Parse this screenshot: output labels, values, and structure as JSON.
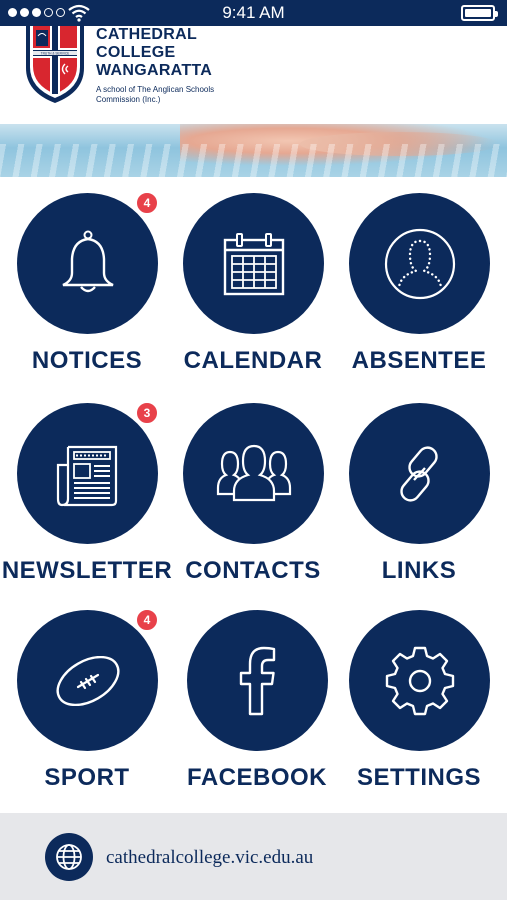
{
  "status_bar": {
    "time": "9:41 AM"
  },
  "header": {
    "school_name_line1": "CATHEDRAL",
    "school_name_line2": "COLLEGE",
    "school_name_line3": "WANGARATTA",
    "subtitle": "A school of The Anglican Schools Commission (Inc.)",
    "crest_motto": "TRUTH & SERVICE"
  },
  "tiles": [
    {
      "label": "NOTICES",
      "icon": "bell-icon",
      "badge": "4"
    },
    {
      "label": "CALENDAR",
      "icon": "calendar-icon"
    },
    {
      "label": "ABSENTEE",
      "icon": "person-dotted-icon"
    },
    {
      "label": "NEWSLETTER",
      "icon": "newspaper-icon",
      "badge": "3"
    },
    {
      "label": "CONTACTS",
      "icon": "group-icon"
    },
    {
      "label": "LINKS",
      "icon": "chain-link-icon"
    },
    {
      "label": "SPORT",
      "icon": "football-icon",
      "badge": "4"
    },
    {
      "label": "FACEBOOK",
      "icon": "facebook-icon"
    },
    {
      "label": "SETTINGS",
      "icon": "gear-icon"
    }
  ],
  "footer": {
    "url": "cathedralcollege.vic.edu.au",
    "icon": "globe-icon"
  },
  "colors": {
    "navy": "#0c2a5b",
    "badge_red": "#e8414a",
    "footer_bg": "#e6e7ea"
  }
}
